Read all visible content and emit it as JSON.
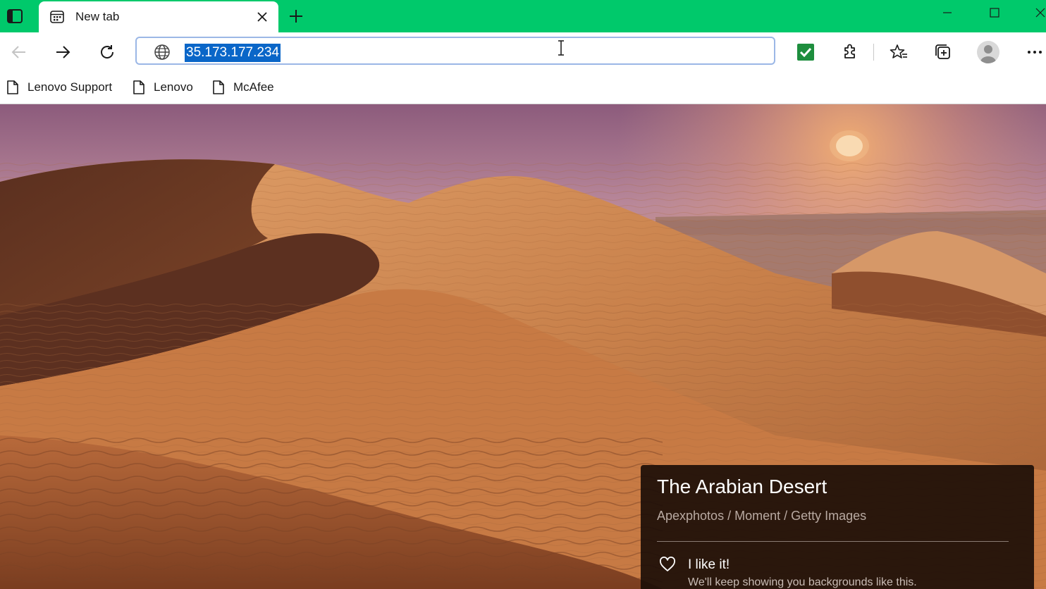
{
  "window": {
    "title_bar_color": "#00c96b"
  },
  "tab": {
    "title": "New tab",
    "favicon": "calendar-grid-icon"
  },
  "toolbar": {
    "address": "35.173.177.234",
    "address_selected": true,
    "icons": [
      "back-icon",
      "forward-icon",
      "refresh-icon",
      "globe-icon",
      "checkmark-extension-icon",
      "extensions-puzzle-icon",
      "favorites-star-icon",
      "collections-icon",
      "profile-avatar-icon",
      "more-options-icon"
    ]
  },
  "favorites": [
    {
      "label": "Lenovo Support"
    },
    {
      "label": "Lenovo"
    },
    {
      "label": "McAfee"
    }
  ],
  "background": {
    "card_title": "The Arabian Desert",
    "credit": "Apexphotos / Moment / Getty Images",
    "like_label": "I like it!",
    "like_subtext": "We'll keep showing you backgrounds like this."
  },
  "colors": {
    "selection": "#0a66c8",
    "address_border": "#9bb7e6",
    "check_extension": "#1e8e3e"
  }
}
